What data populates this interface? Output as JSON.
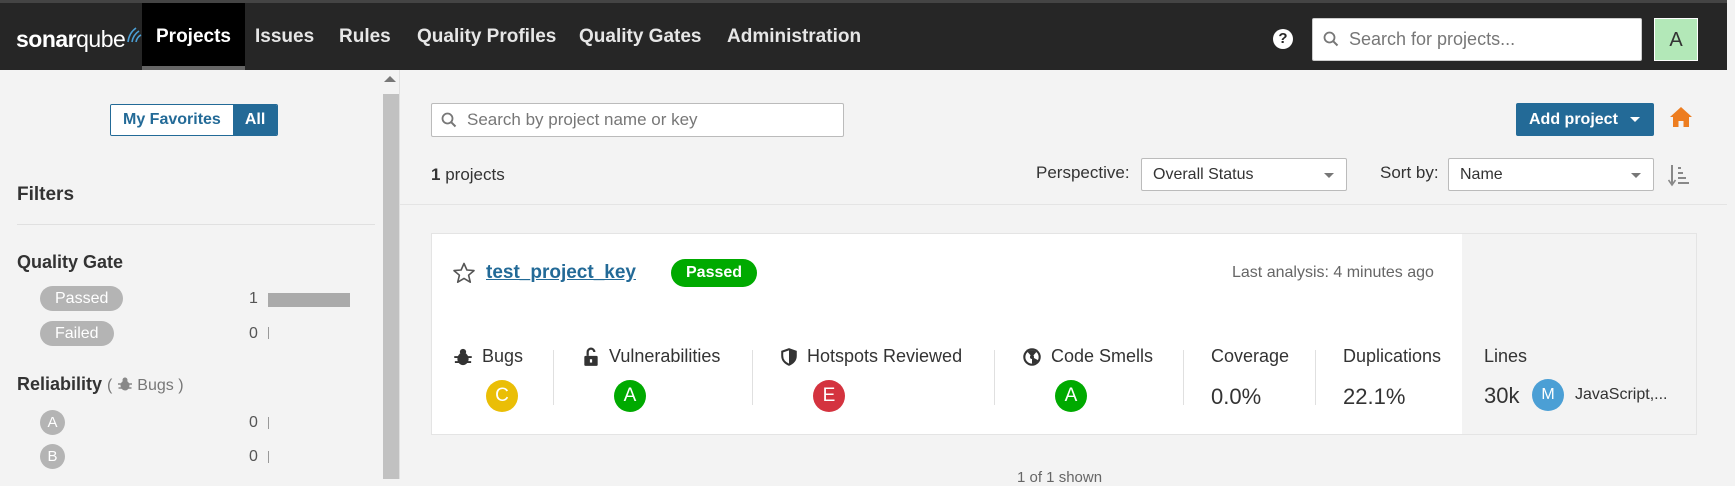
{
  "nav": {
    "brand_bold": "sonar",
    "brand_light": "qube",
    "items": [
      "Projects",
      "Issues",
      "Rules",
      "Quality Profiles",
      "Quality Gates",
      "Administration"
    ],
    "active": "Projects",
    "help_glyph": "?",
    "search_placeholder": "Search for projects...",
    "avatar_letter": "A",
    "avatar_color": "#b3e8b8"
  },
  "sidebar": {
    "toggle": {
      "favorites": "My Favorites",
      "all": "All",
      "selected": "All"
    },
    "filters_title": "Filters",
    "quality_gate": {
      "title": "Quality Gate",
      "options": [
        {
          "label": "Passed",
          "count": "1",
          "fraction": 1.0
        },
        {
          "label": "Failed",
          "count": "0",
          "fraction": 0
        }
      ]
    },
    "reliability": {
      "title": "Reliability",
      "open_paren": "(",
      "subtitle": "Bugs",
      "close_paren": ")",
      "options": [
        {
          "label": "A",
          "count": "0"
        },
        {
          "label": "B",
          "count": "0"
        }
      ]
    }
  },
  "main": {
    "search_placeholder": "Search by project name or key",
    "add_project": "Add project",
    "projects_count": "1",
    "projects_label": "projects",
    "perspective_label": "Perspective:",
    "perspective_value": "Overall Status",
    "sort_label": "Sort by:",
    "sort_value": "Name",
    "footer": "1 of 1 shown"
  },
  "project": {
    "name": "test_project_key",
    "quality_gate": "Passed",
    "last_analysis": "Last analysis: 4 minutes ago",
    "metrics": {
      "bugs": {
        "label": "Bugs",
        "rating": "C",
        "color": "#eabe06"
      },
      "vulnerabilities": {
        "label": "Vulnerabilities",
        "rating": "A",
        "color": "#00aa00"
      },
      "hotspots": {
        "label": "Hotspots Reviewed",
        "rating": "E",
        "color": "#d4333f"
      },
      "code_smells": {
        "label": "Code Smells",
        "rating": "A",
        "color": "#00aa00"
      },
      "coverage": {
        "label": "Coverage",
        "value": "0.0%"
      },
      "duplications": {
        "label": "Duplications",
        "value": "22.1%"
      },
      "lines": {
        "label": "Lines",
        "value": "30k",
        "size_badge": "M",
        "languages": "JavaScript,..."
      }
    }
  },
  "colors": {
    "accent": "#236a97",
    "passed": "#00aa00",
    "home": "#ed7d20"
  }
}
